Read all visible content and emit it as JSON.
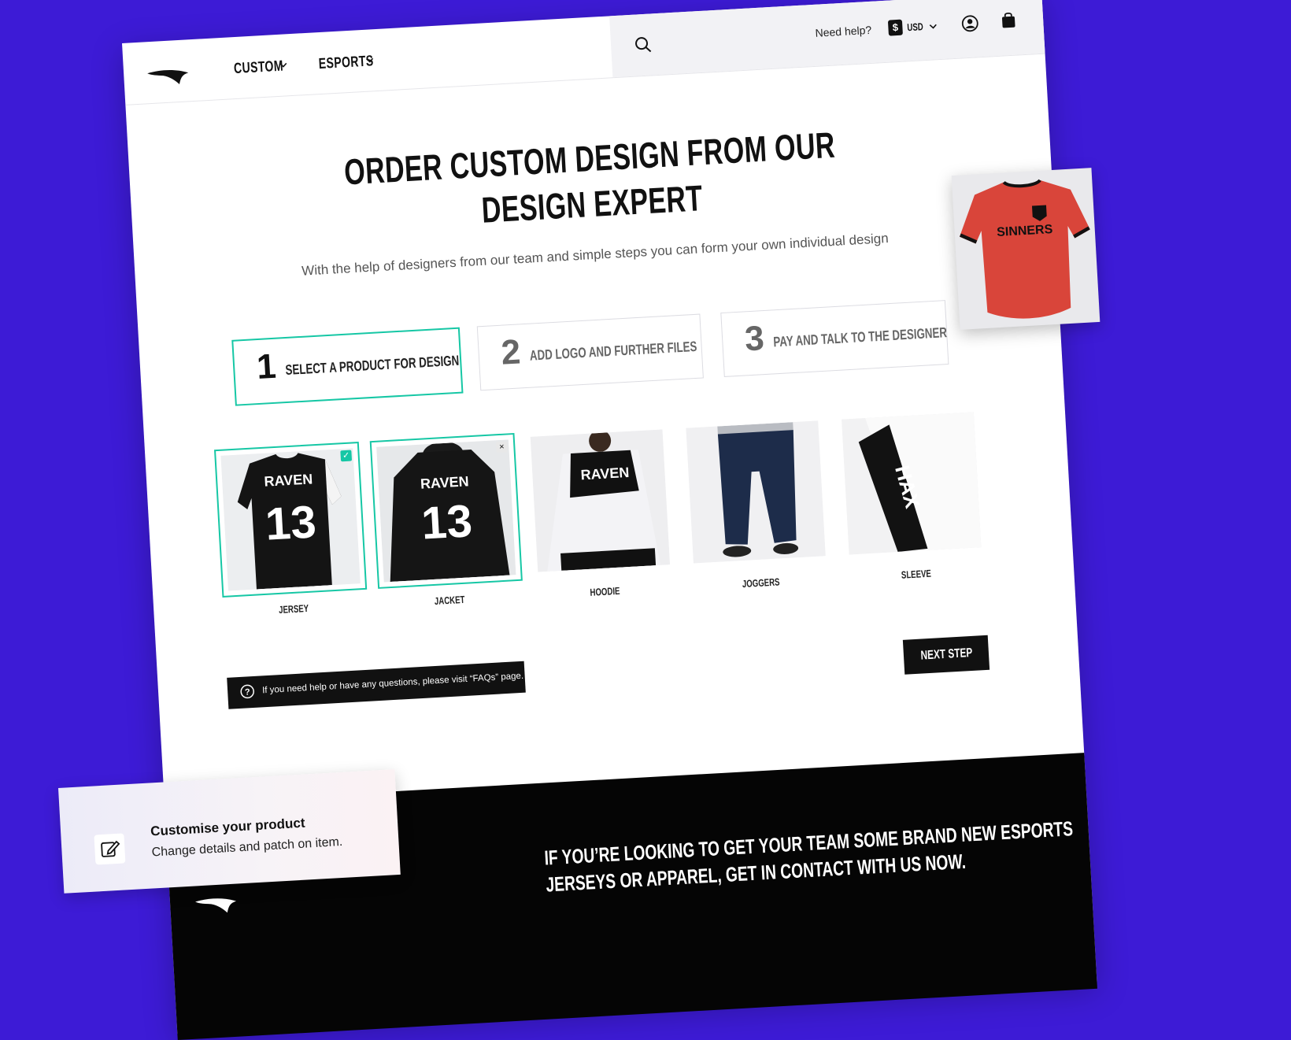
{
  "nav": {
    "items": [
      {
        "label": "CUSTOM"
      },
      {
        "label": "ESPORTS"
      }
    ],
    "help": "Need help?",
    "currency_symbol": "$",
    "currency": "USD"
  },
  "hero": {
    "title_line1": "ORDER CUSTOM DESIGN FROM OUR",
    "title_line2": "DESIGN EXPERT",
    "subtitle": "With the help of designers from our team and simple steps you can form your own individual design"
  },
  "steps": [
    {
      "num": "1",
      "label": "SELECT A PRODUCT FOR DESIGN",
      "active": true
    },
    {
      "num": "2",
      "label": "ADD LOGO AND FURTHER FILES",
      "active": false
    },
    {
      "num": "3",
      "label": "PAY AND TALK TO THE DESIGNER",
      "active": false
    }
  ],
  "products": [
    {
      "label": "JERSEY",
      "selected": true,
      "badge": "✓",
      "print_name": "RAVEN",
      "print_number": "13"
    },
    {
      "label": "JACKET",
      "selected": true,
      "badge": "×",
      "print_name": "RAVEN",
      "print_number": "13"
    },
    {
      "label": "HOODIE",
      "selected": false,
      "print_name": "RAVEN"
    },
    {
      "label": "JOGGERS",
      "selected": false
    },
    {
      "label": "SLEEVE",
      "selected": false,
      "print_name": "HAX"
    }
  ],
  "faq_text": "If you need help or have any questions, please visit “FAQs” page.",
  "next_step": "NEXT STEP",
  "footer": {
    "line1": "IF YOU’RE LOOKING TO GET YOUR TEAM SOME BRAND NEW ESPORTS",
    "line2": "JERSEYS OR APPAREL, GET IN CONTACT WITH US NOW."
  },
  "jersey_preview": {
    "brand": "SINNERS"
  },
  "customise": {
    "title": "Customise your product",
    "subtitle": "Change details and patch on item."
  },
  "colors": {
    "background": "#3d1bd6",
    "accent": "#16c7a5",
    "jersey": "#d9453a",
    "dark": "#111111"
  }
}
